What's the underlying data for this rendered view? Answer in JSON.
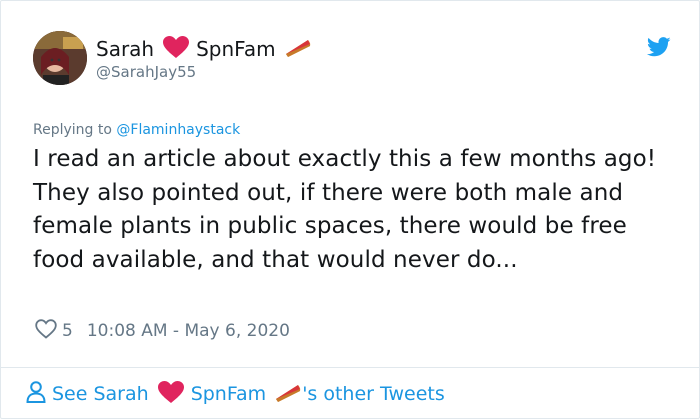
{
  "tweet": {
    "author": {
      "display_name_part1": "Sarah",
      "display_name_part2": "SpnFam",
      "handle": "@SarahJay55",
      "emoji_heart": "heart-icon",
      "emoji_pie": "pie-icon"
    },
    "replying": {
      "prefix": "Replying to ",
      "handle": "@Flaminhaystack"
    },
    "text_lines": [
      "I read an article about exactly this a few months ago!",
      "They also pointed out, if there were both male and female plants in public spaces, there would be free food available, and that would never do..."
    ],
    "likes": "5",
    "timestamp": "10:08 AM - May 6, 2020",
    "see_more": {
      "prefix": "See Sarah",
      "name2": "SpnFam",
      "suffix": "'s other Tweets"
    }
  },
  "colors": {
    "link": "#1b95e0",
    "muted": "#657786",
    "heart": "#e0245e",
    "border": "#e1e8ed"
  }
}
